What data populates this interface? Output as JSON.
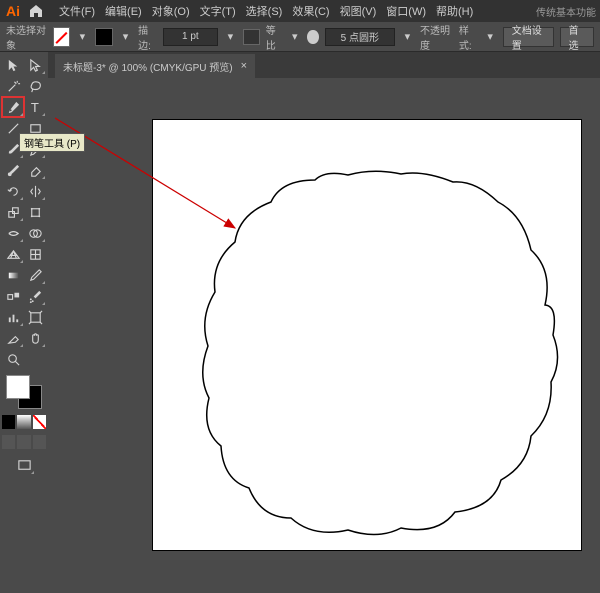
{
  "app": {
    "logo": "Ai"
  },
  "menu": {
    "items": [
      "文件(F)",
      "编辑(E)",
      "对象(O)",
      "文字(T)",
      "选择(S)",
      "效果(C)",
      "视图(V)",
      "窗口(W)",
      "帮助(H)"
    ],
    "workspace": "传统基本功能"
  },
  "options": {
    "no_selection": "未选择对象",
    "stroke_label": "描边:",
    "stroke_value": "1 pt",
    "uniform": "等比",
    "points_value": "5 点圆形",
    "opacity_label": "不透明度",
    "style_label": "样式:",
    "doc_setup": "文档设置",
    "prefs": "首选"
  },
  "tab": {
    "title": "未标题-3* @ 100% (CMYK/GPU 预览)",
    "close": "×"
  },
  "tooltip": "钢笔工具 (P)"
}
